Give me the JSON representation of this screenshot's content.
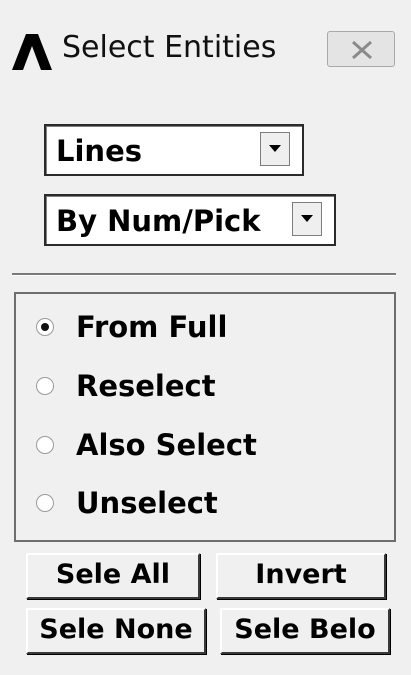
{
  "window": {
    "title": "Select Entities",
    "close_icon": "close-x-icon",
    "logo_icon": "ansys-logo-icon"
  },
  "entity_type": {
    "selected": "Lines"
  },
  "select_method": {
    "selected": "By Num/Pick"
  },
  "selection_mode": {
    "selected": "From Full",
    "options": [
      "From Full",
      "Reselect",
      "Also Select",
      "Unselect"
    ]
  },
  "buttons": {
    "sele_all": "Sele All",
    "invert": "Invert",
    "sele_none": "Sele None",
    "sele_below": "Sele Belo"
  }
}
